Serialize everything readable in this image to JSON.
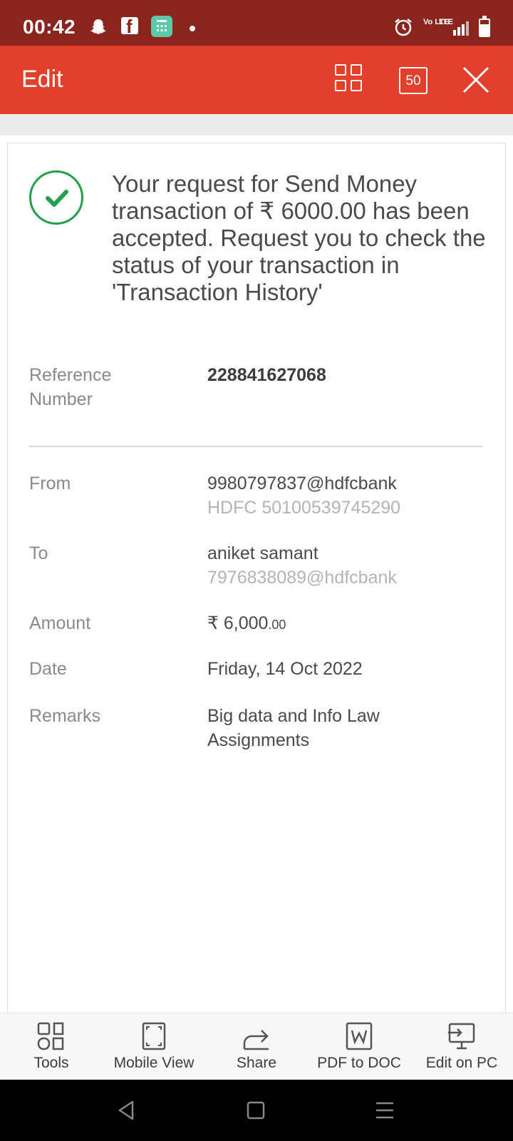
{
  "status_bar": {
    "time": "00:42",
    "network": "Vo LTE",
    "network_type": "LTE",
    "icons": [
      "snapchat-icon",
      "facebook-icon",
      "calculator-icon",
      "dot-icon",
      "alarm-icon",
      "signal-icon",
      "battery-icon"
    ]
  },
  "toolbar": {
    "title": "Edit",
    "page_count": "50",
    "icons": [
      "grid-view-icon",
      "page-count-icon",
      "close-icon"
    ]
  },
  "card": {
    "message": "Your request for Send Money transaction of ₹ 6000.00 has been accepted. Request you to check the status of your transaction in 'Transaction History'",
    "reference_label": "Reference Number",
    "reference_value": "228841627068",
    "from_label": "From",
    "from_value": "9980797837@hdfcbank",
    "from_sub": "HDFC 50100539745290",
    "to_label": "To",
    "to_value": "aniket samant",
    "to_sub": "7976838089@hdfcbank",
    "amount_label": "Amount",
    "amount_main": "₹ 6,000",
    "amount_decimal": ".00",
    "date_label": "Date",
    "date_value": "Friday, 14 Oct 2022",
    "remarks_label": "Remarks",
    "remarks_value": "Big data and Info Law Assignments",
    "status_color": "#21a14b"
  },
  "actions": [
    {
      "label": "Tools",
      "icon": "tools-icon"
    },
    {
      "label": "Mobile View",
      "icon": "mobile-view-icon"
    },
    {
      "label": "Share",
      "icon": "share-icon"
    },
    {
      "label": "PDF to DOC",
      "icon": "word-doc-icon"
    },
    {
      "label": "Edit on PC",
      "icon": "edit-on-pc-icon"
    }
  ],
  "nav": {
    "icons": [
      "back-icon",
      "home-icon",
      "recents-icon"
    ]
  },
  "colors": {
    "status_bar": "#8b241c",
    "toolbar": "#e2402b",
    "accent_green": "#21a14b"
  }
}
